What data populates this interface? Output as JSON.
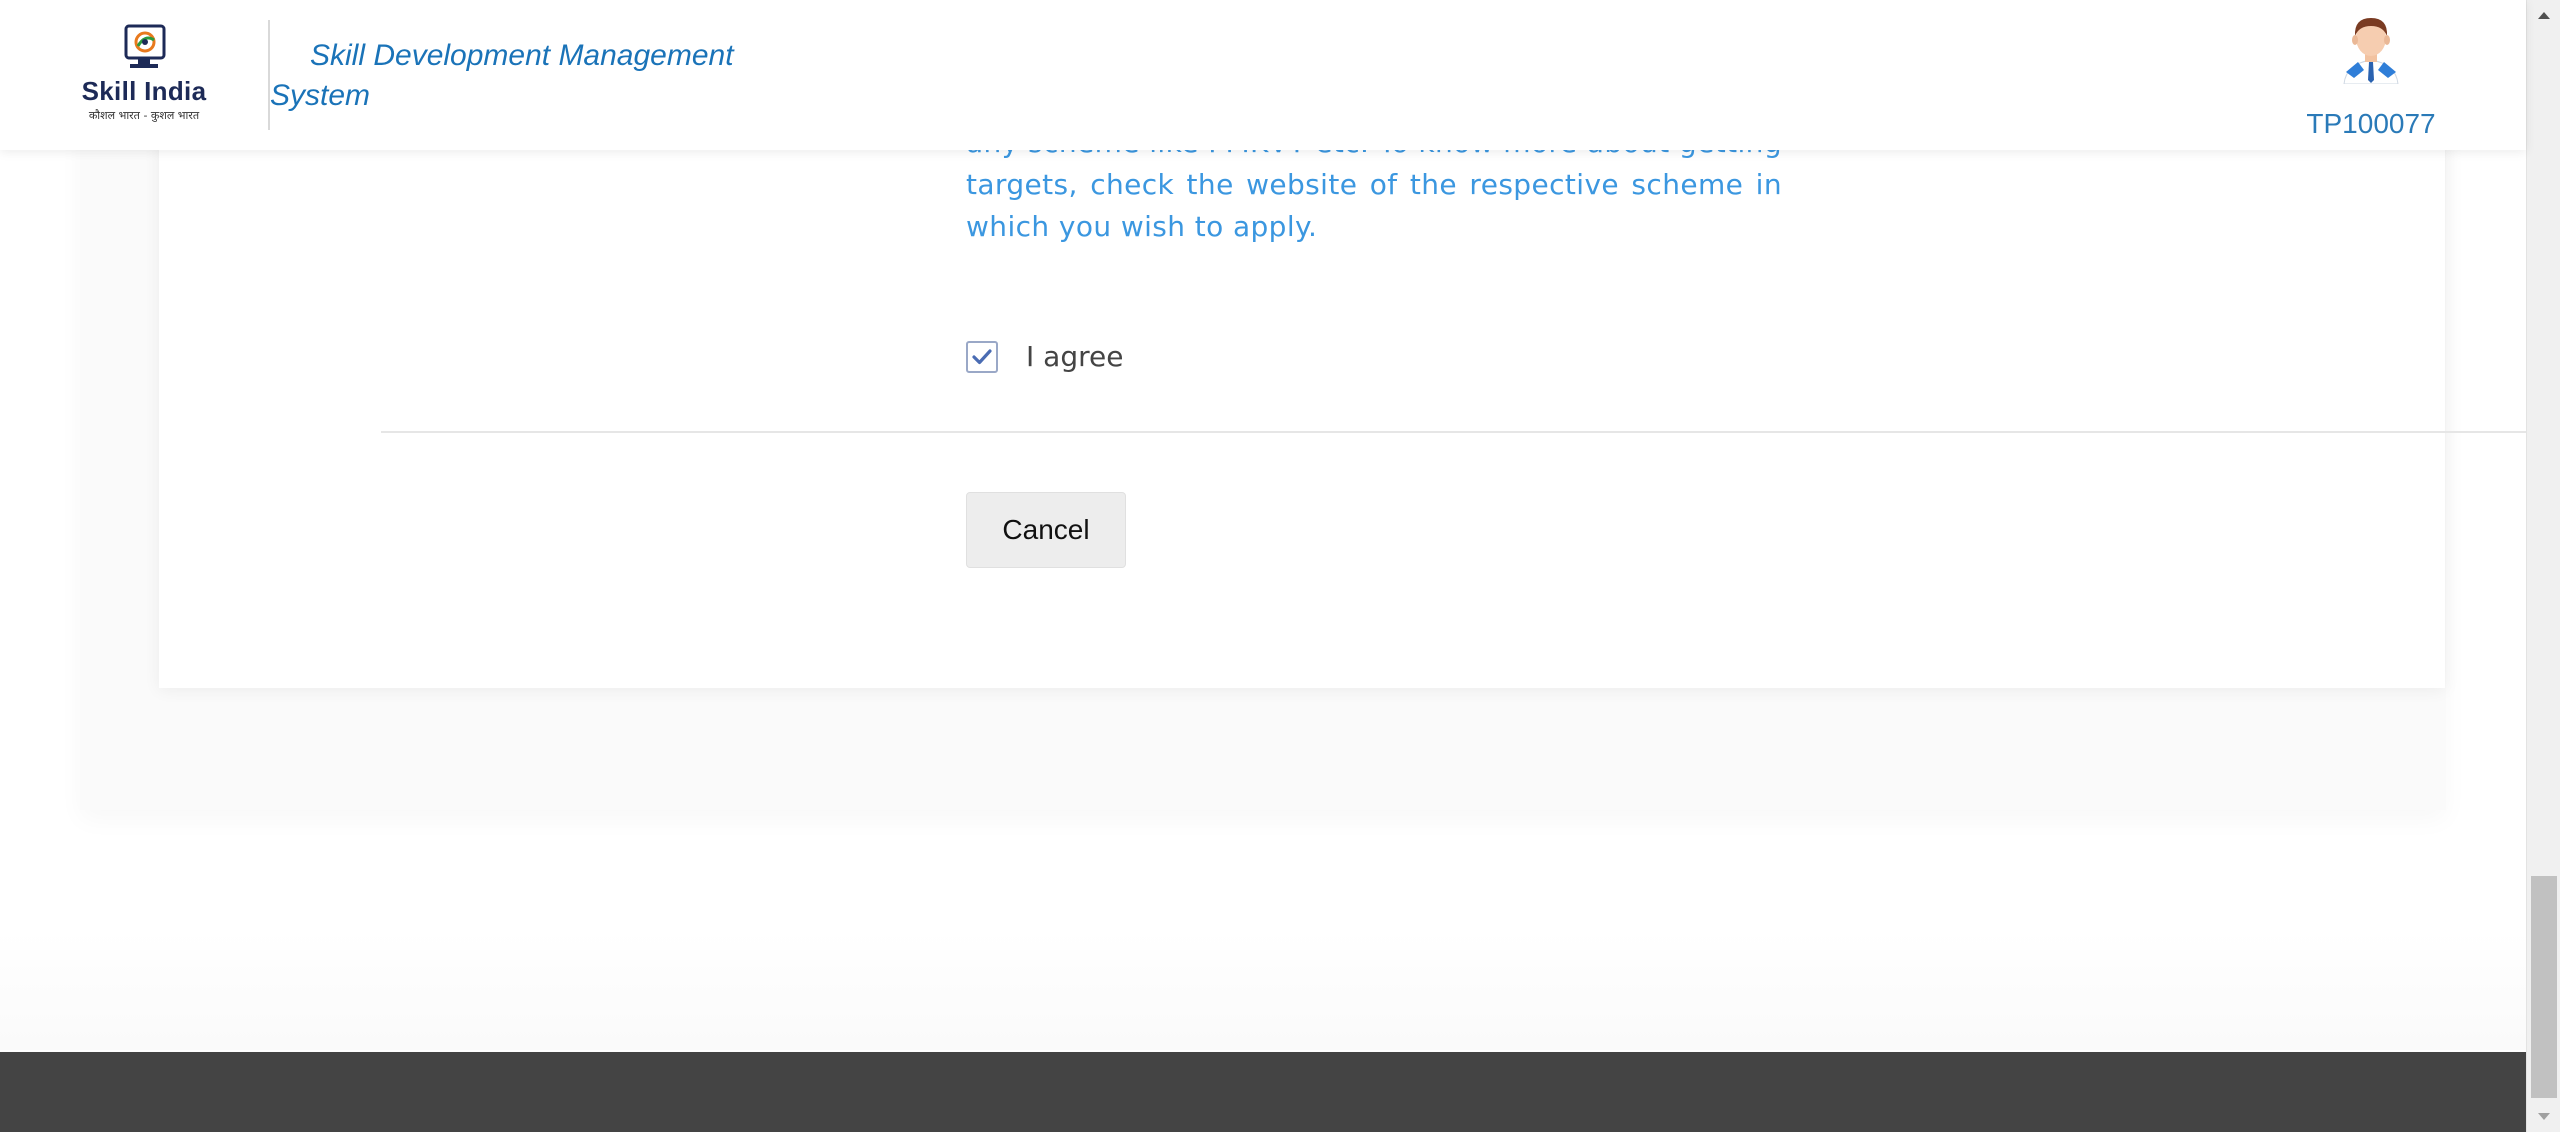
{
  "header": {
    "logo_text": "Skill India",
    "logo_subtext": "कौशल भारत - कुशल भारत",
    "app_title": "Skill Development Management System",
    "user_id": "TP100077"
  },
  "form": {
    "notice_text": "any scheme like PMKVY etc. To know more about getting targets, check the website of the respective scheme in which you wish to apply.",
    "agree_label": "I agree",
    "agree_checked": "true",
    "cancel_label": "Cancel"
  },
  "colors": {
    "accent": "#1a73b8",
    "notice_text": "#3b97e0",
    "footer": "#444444"
  },
  "icons": {
    "logo": "skill-india-logo",
    "avatar": "user-avatar-icon",
    "check": "checkmark-icon",
    "scroll_up": "scroll-up-arrow-icon",
    "scroll_down": "scroll-down-arrow-icon"
  }
}
